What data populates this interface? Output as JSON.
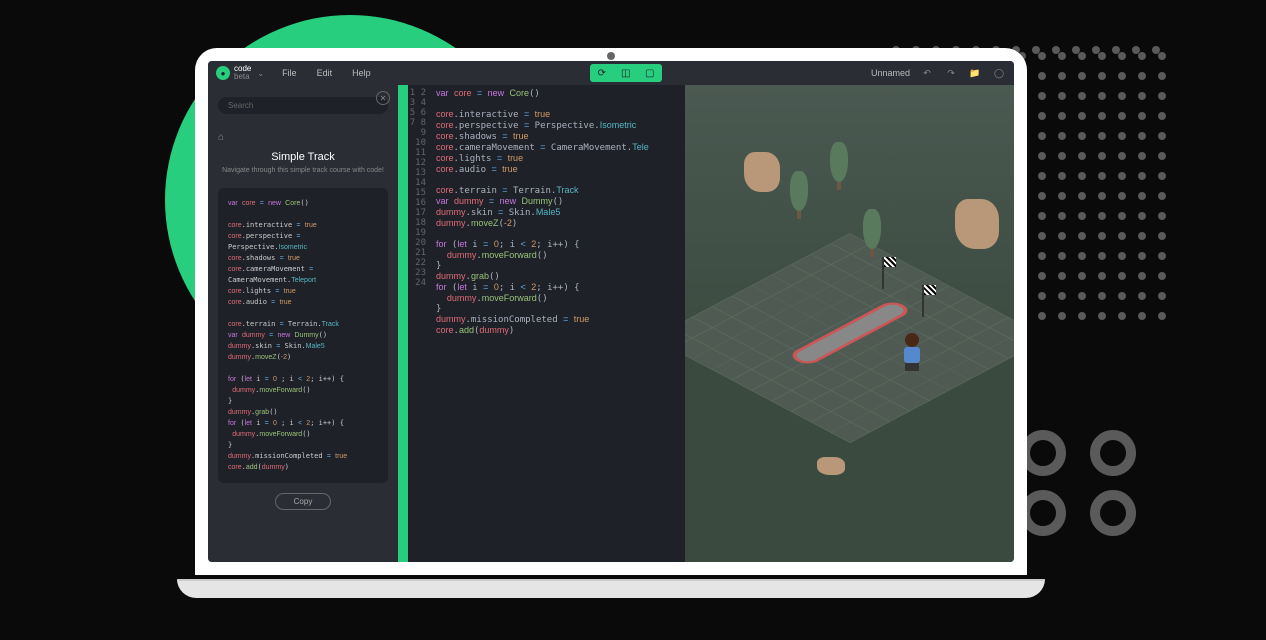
{
  "app": {
    "name": "code",
    "sub": "beta"
  },
  "menu": {
    "file": "File",
    "edit": "Edit",
    "help": "Help"
  },
  "project": {
    "name": "Unnamed"
  },
  "sidebar": {
    "search_placeholder": "Search",
    "title": "Simple Track",
    "subtitle": "Navigate through this simple track course with code!",
    "copy": "Copy"
  },
  "snippet": {
    "lines": [
      {
        "html": "<span class='kw'>var</span> <span class='var'>core</span> <span class='op'>=</span> <span class='kw'>new</span> <span class='fn'>Core</span>()"
      },
      {
        "html": ""
      },
      {
        "html": "<span class='var'>core</span>.interactive <span class='op'>=</span> <span class='val'>true</span>"
      },
      {
        "html": "<span class='var'>core</span>.perspective <span class='op'>=</span> Perspective.<span class='str'>Isometric</span>"
      },
      {
        "html": "<span class='var'>core</span>.shadows <span class='op'>=</span> <span class='val'>true</span>"
      },
      {
        "html": "<span class='var'>core</span>.cameraMovement <span class='op'>=</span> CameraMovement.<span class='str'>Teleport</span>"
      },
      {
        "html": "<span class='var'>core</span>.lights <span class='op'>=</span> <span class='val'>true</span>"
      },
      {
        "html": "<span class='var'>core</span>.audio <span class='op'>=</span> <span class='val'>true</span>"
      },
      {
        "html": ""
      },
      {
        "html": "<span class='var'>core</span>.terrain <span class='op'>=</span> Terrain.<span class='str'>Track</span>"
      },
      {
        "html": "<span class='kw'>var</span> <span class='var'>dummy</span> <span class='op'>=</span> <span class='kw'>new</span> <span class='fn'>Dummy</span>()"
      },
      {
        "html": "<span class='var'>dummy</span>.skin <span class='op'>=</span> Skin.<span class='str'>Male5</span>"
      },
      {
        "html": "<span class='var'>dummy</span>.<span class='fn'>moveZ</span>(<span class='val'>-2</span>)"
      },
      {
        "html": ""
      },
      {
        "html": "<span class='kw'>for</span> (<span class='kw'>let</span> i <span class='op'>=</span> <span class='val'>0</span> ; i <span class='op'>&lt;</span> <span class='val'>2</span>; i++) {"
      },
      {
        "html": "&nbsp;<span class='var'>dummy</span>.<span class='fn'>moveForward</span>()"
      },
      {
        "html": "}"
      },
      {
        "html": "<span class='var'>dummy</span>.<span class='fn'>grab</span>()"
      },
      {
        "html": "<span class='kw'>for</span> (<span class='kw'>let</span> i <span class='op'>=</span> <span class='val'>0</span> ; i <span class='op'>&lt;</span> <span class='val'>2</span>; i++) {"
      },
      {
        "html": "&nbsp;<span class='var'>dummy</span>.<span class='fn'>moveForward</span>()"
      },
      {
        "html": "}"
      },
      {
        "html": "<span class='var'>dummy</span>.missionCompleted <span class='op'>=</span> <span class='val'>true</span>"
      },
      {
        "html": "<span class='var'>core</span>.<span class='fn'>add</span>(<span class='var'>dummy</span>)"
      }
    ]
  },
  "editor": {
    "line_count": 24,
    "lines": [
      "<span class='kw'>var</span> <span class='var'>core</span> <span class='op'>=</span> <span class='kw'>new</span> <span class='fn'>Core</span>()",
      "",
      "<span class='var'>core</span>.interactive <span class='op'>=</span> <span class='val'>true</span>",
      "<span class='var'>core</span>.perspective <span class='op'>=</span> Perspective.<span class='str'>Isometric</span>",
      "<span class='var'>core</span>.shadows <span class='op'>=</span> <span class='val'>true</span>",
      "<span class='var'>core</span>.cameraMovement <span class='op'>=</span> CameraMovement.<span class='str'>Tele</span>",
      "<span class='var'>core</span>.lights <span class='op'>=</span> <span class='val'>true</span>",
      "<span class='var'>core</span>.audio <span class='op'>=</span> <span class='val'>true</span>",
      "",
      "<span class='var'>core</span>.terrain <span class='op'>=</span> Terrain.<span class='str'>Track</span>",
      "<span class='kw'>var</span> <span class='var'>dummy</span> <span class='op'>=</span> <span class='kw'>new</span> <span class='fn'>Dummy</span>()",
      "<span class='var'>dummy</span>.skin <span class='op'>=</span> Skin.<span class='str'>Male5</span>",
      "<span class='var'>dummy</span>.<span class='fn'>moveZ</span>(<span class='val'>-2</span>)",
      "",
      "<span class='kw'>for</span> (<span class='kw'>let</span> i <span class='op'>=</span> <span class='val'>0</span>; i <span class='op'>&lt;</span> <span class='val'>2</span>; i++) {",
      "  <span class='var'>dummy</span>.<span class='fn'>moveForward</span>()",
      "}",
      "<span class='var'>dummy</span>.<span class='fn'>grab</span>()",
      "<span class='kw'>for</span> (<span class='kw'>let</span> i <span class='op'>=</span> <span class='val'>0</span>; i <span class='op'>&lt;</span> <span class='val'>2</span>; i++) {",
      "  <span class='var'>dummy</span>.<span class='fn'>moveForward</span>()",
      "}",
      "<span class='var'>dummy</span>.missionCompleted <span class='op'>=</span> <span class='val'>true</span>",
      "<span class='var'>core</span>.<span class='fn'>add</span>(<span class='var'>dummy</span>)",
      ""
    ]
  },
  "colors": {
    "accent": "#27ce7e",
    "bg": "#1e2128"
  }
}
